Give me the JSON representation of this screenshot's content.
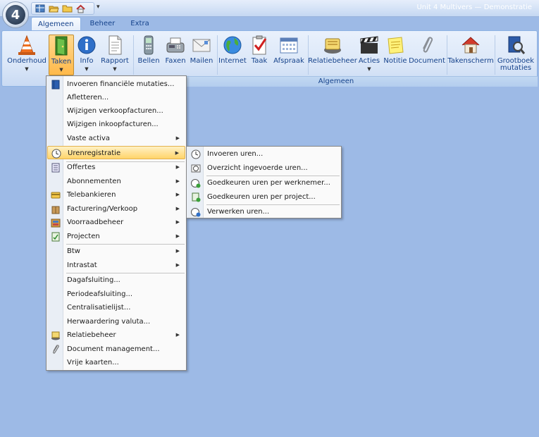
{
  "app": {
    "logo_text": "4",
    "window_title": "Unit 4 Multivers — Demonstratie"
  },
  "colors": {
    "desktop": "#9dbae6",
    "highlight": "#ffd46a",
    "ribbon": "#dbe7f8"
  },
  "qat": {
    "icons": [
      "grid-icon",
      "folder-open-icon",
      "folder-icon",
      "home-icon"
    ],
    "dropdown": "▾"
  },
  "tabs": [
    {
      "label": "Algemeen",
      "active": true
    },
    {
      "label": "Beheer",
      "active": false
    },
    {
      "label": "Extra",
      "active": false
    }
  ],
  "ribbon": {
    "group_label": "Algemeen",
    "buttons": [
      {
        "label": "Onderhoud",
        "icon": "traffic-cone-icon",
        "dropdown": true
      },
      {
        "label": "Taken",
        "icon": "door-icon",
        "dropdown": true,
        "pressed": true
      },
      {
        "label": "Info",
        "icon": "info-icon",
        "dropdown": true
      },
      {
        "label": "Rapport",
        "icon": "report-icon",
        "dropdown": true
      },
      {
        "label": "Bellen",
        "icon": "phone-icon"
      },
      {
        "label": "Faxen",
        "icon": "fax-icon"
      },
      {
        "label": "Mailen",
        "icon": "mail-icon"
      },
      {
        "label": "Internet",
        "icon": "globe-icon"
      },
      {
        "label": "Taak",
        "icon": "checklist-icon"
      },
      {
        "label": "Afspraak",
        "icon": "calendar-icon"
      },
      {
        "label": "Relatiebeheer",
        "icon": "contacts-icon"
      },
      {
        "label": "Acties",
        "icon": "clapperboard-icon",
        "dropdown": true
      },
      {
        "label": "Notitie",
        "icon": "note-icon"
      },
      {
        "label": "Document",
        "icon": "paperclip-icon"
      },
      {
        "label": "Takenscherm",
        "icon": "house-icon"
      },
      {
        "label": "Grootboek mutaties",
        "icon": "ledger-search-icon"
      }
    ]
  },
  "menu": {
    "items": [
      {
        "label": "Invoeren financiële mutaties...",
        "icon": "book-icon",
        "submenu": false
      },
      {
        "label": "Afletteren...",
        "submenu": false
      },
      {
        "label": "Wijzigen verkoopfacturen...",
        "submenu": false
      },
      {
        "label": "Wijzigen inkoopfacturen...",
        "submenu": false
      },
      {
        "label": "Vaste activa",
        "submenu": true
      },
      {
        "label": "Urenregistratie",
        "icon": "clock-icon",
        "submenu": true,
        "highlighted": true
      },
      {
        "label": "Offertes",
        "icon": "form-icon",
        "submenu": true
      },
      {
        "label": "Abonnementen",
        "submenu": true
      },
      {
        "label": "Telebankieren",
        "icon": "bank-card-icon",
        "submenu": true
      },
      {
        "label": "Facturering/Verkoop",
        "icon": "package-icon",
        "submenu": true
      },
      {
        "label": "Voorraadbeheer",
        "icon": "stock-icon",
        "submenu": true
      },
      {
        "label": "Projecten",
        "icon": "project-icon",
        "submenu": true
      },
      {
        "label": "Btw",
        "submenu": true
      },
      {
        "label": "Intrastat",
        "submenu": true
      },
      {
        "label": "Dagafsluiting...",
        "submenu": false
      },
      {
        "label": "Periodeafsluiting...",
        "submenu": false
      },
      {
        "label": "Centralisatielijst...",
        "submenu": false
      },
      {
        "label": "Herwaardering valuta...",
        "submenu": false
      },
      {
        "label": "Relatiebeheer",
        "icon": "contacts-icon",
        "submenu": true
      },
      {
        "label": "Document management...",
        "icon": "paperclip-icon",
        "submenu": false
      },
      {
        "label": "Vrije kaarten...",
        "submenu": false
      }
    ]
  },
  "submenu": {
    "items": [
      {
        "label": "Invoeren uren...",
        "icon": "clock-icon"
      },
      {
        "label": "Overzicht ingevoerde uren...",
        "icon": "clock-list-icon"
      },
      {
        "label": "Goedkeuren uren per werknemer...",
        "icon": "clock-approve-icon"
      },
      {
        "label": "Goedkeuren uren per project...",
        "icon": "project-approve-icon"
      },
      {
        "label": "Verwerken uren...",
        "icon": "clock-process-icon"
      }
    ]
  }
}
